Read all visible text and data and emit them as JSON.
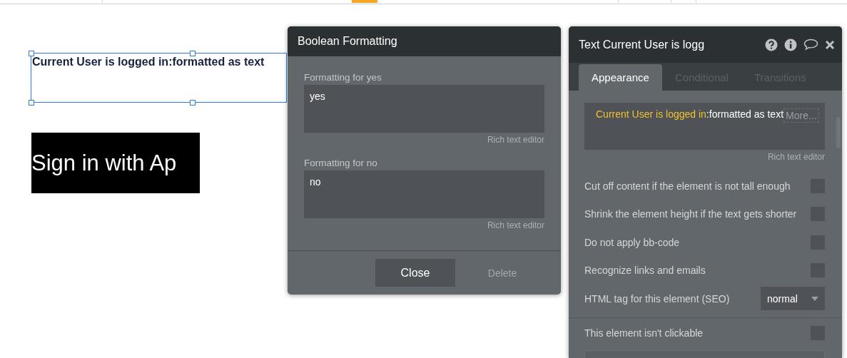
{
  "canvas": {
    "text_element": {
      "text": "Current User is logged in:formatted as text",
      "selected": true
    },
    "button": {
      "text": "Sign in with Ap"
    }
  },
  "dialog": {
    "title": "Boolean Formatting",
    "fields": [
      {
        "label": "Formatting for yes",
        "value": "yes",
        "hint": "Rich text editor"
      },
      {
        "label": "Formatting for no",
        "value": "no",
        "hint": "Rich text editor"
      }
    ],
    "buttons": [
      {
        "label": "Close",
        "disabled": false
      },
      {
        "label": "Delete",
        "disabled": true
      }
    ]
  },
  "property_editor": {
    "title": "Text Current User is logg",
    "tabs": [
      {
        "label": "Appearance",
        "selected": true
      },
      {
        "label": "Conditional",
        "selected": false
      },
      {
        "label": "Transitions",
        "selected": false
      }
    ],
    "expression": {
      "dynamic": "Current User is logged in",
      "static": ":formatted as text",
      "more": "More..."
    },
    "hint": "Rich text editor",
    "options": [
      {
        "kind": "checkbox",
        "label": "Cut off content if the element is not tall enough",
        "checked": false
      },
      {
        "kind": "checkbox",
        "label": "Shrink the element height if the text gets shorter",
        "checked": false
      },
      {
        "kind": "checkbox",
        "label": "Do not apply bb-code",
        "checked": false
      },
      {
        "kind": "checkbox",
        "label": "Recognize links and emails",
        "checked": false
      },
      {
        "kind": "dropdown",
        "label": "HTML tag for this element (SEO)",
        "value": "normal"
      }
    ],
    "bottom_options": [
      {
        "kind": "checkbox",
        "label": "This element isn't clickable",
        "checked": false
      }
    ]
  }
}
